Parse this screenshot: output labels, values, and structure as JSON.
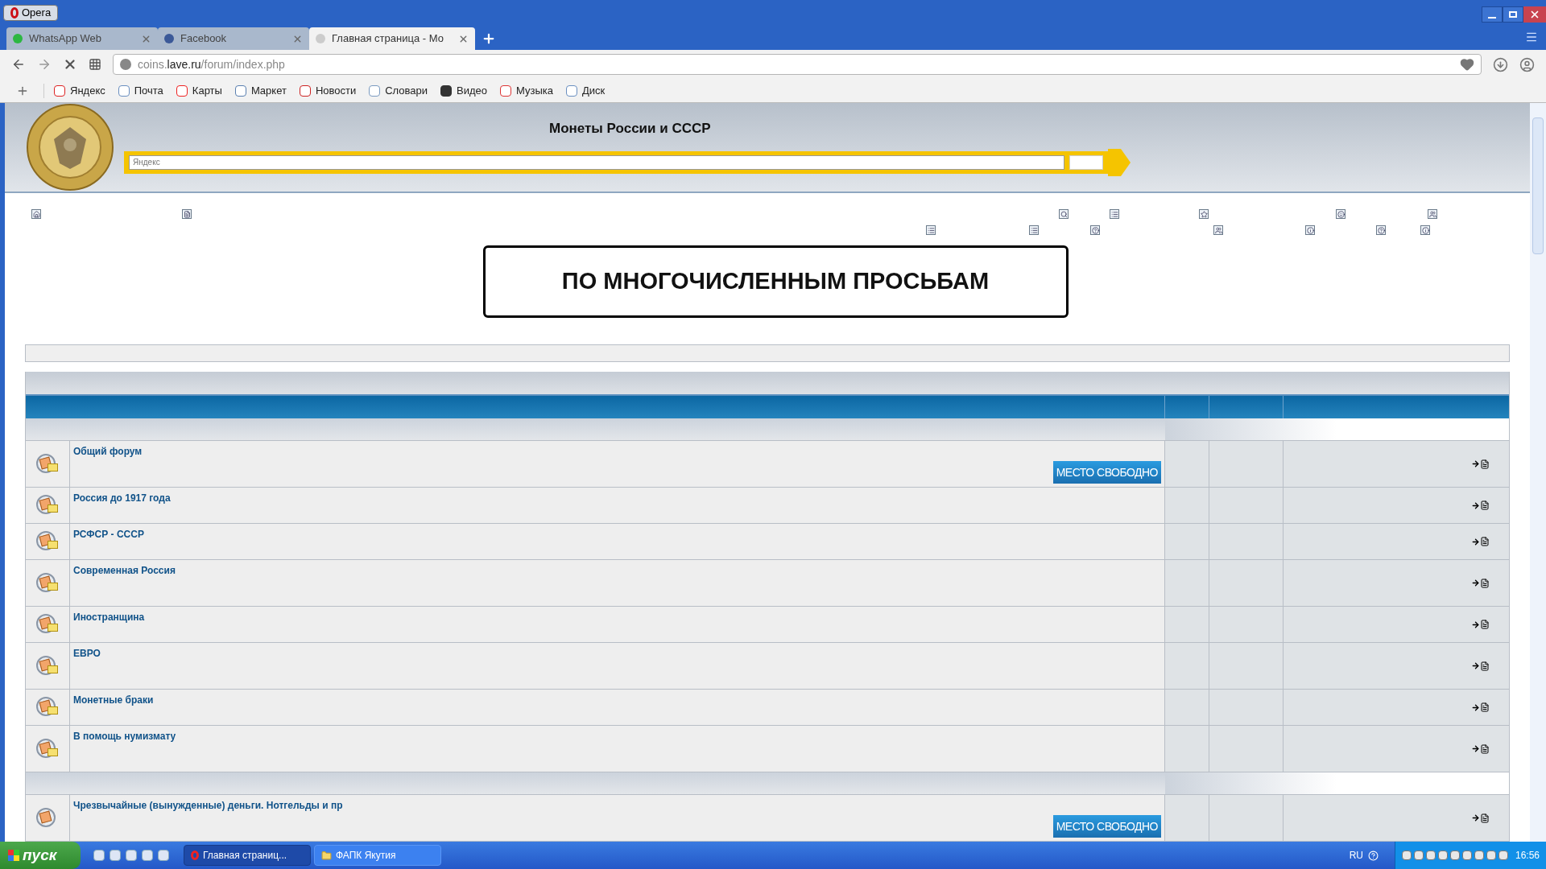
{
  "browser": {
    "app_button": "Opera",
    "tabs": [
      {
        "title": "WhatsApp Web",
        "selected": false
      },
      {
        "title": "Facebook",
        "selected": false
      },
      {
        "title": "Главная страница - Мо",
        "selected": true
      }
    ],
    "address": {
      "prefix": "coins.",
      "domain": "lave.ru",
      "path": "/forum/index.php"
    },
    "bookmarks": [
      "Яндекс",
      "Почта",
      "Карты",
      "Маркет",
      "Новости",
      "Словари",
      "Видео",
      "Музыка",
      "Диск"
    ]
  },
  "page": {
    "site_title": "Монеты России и СССР",
    "search": {
      "placeholder": "Яндекс"
    },
    "banner": "ПО МНОГОЧИСЛЕННЫМ ПРОСЬБАМ",
    "categories": [
      {
        "forums": [
          {
            "name": "Общий форум",
            "ad": "МЕСТО СВОБОДНО"
          },
          {
            "name": "Россия до 1917 года"
          },
          {
            "name": "РСФСР - СССР"
          },
          {
            "name": "Современная Россия"
          },
          {
            "name": "Иностранщина"
          },
          {
            "name": "ЕВРО"
          },
          {
            "name": "Монетные браки"
          },
          {
            "name": "В помощь нумизмату"
          }
        ]
      },
      {
        "forums": [
          {
            "name": "Чрезвычайные (вынужденные) деньги. Нотгельды и пр",
            "ad": "МЕСТО СВОБОДНО"
          }
        ]
      }
    ]
  },
  "taskbar": {
    "start": "пуск",
    "windows": [
      {
        "title": "Главная страниц...",
        "selected": true
      },
      {
        "title": "ФАПК Якутия",
        "selected": false
      }
    ],
    "language": "RU",
    "time": "16:56"
  }
}
